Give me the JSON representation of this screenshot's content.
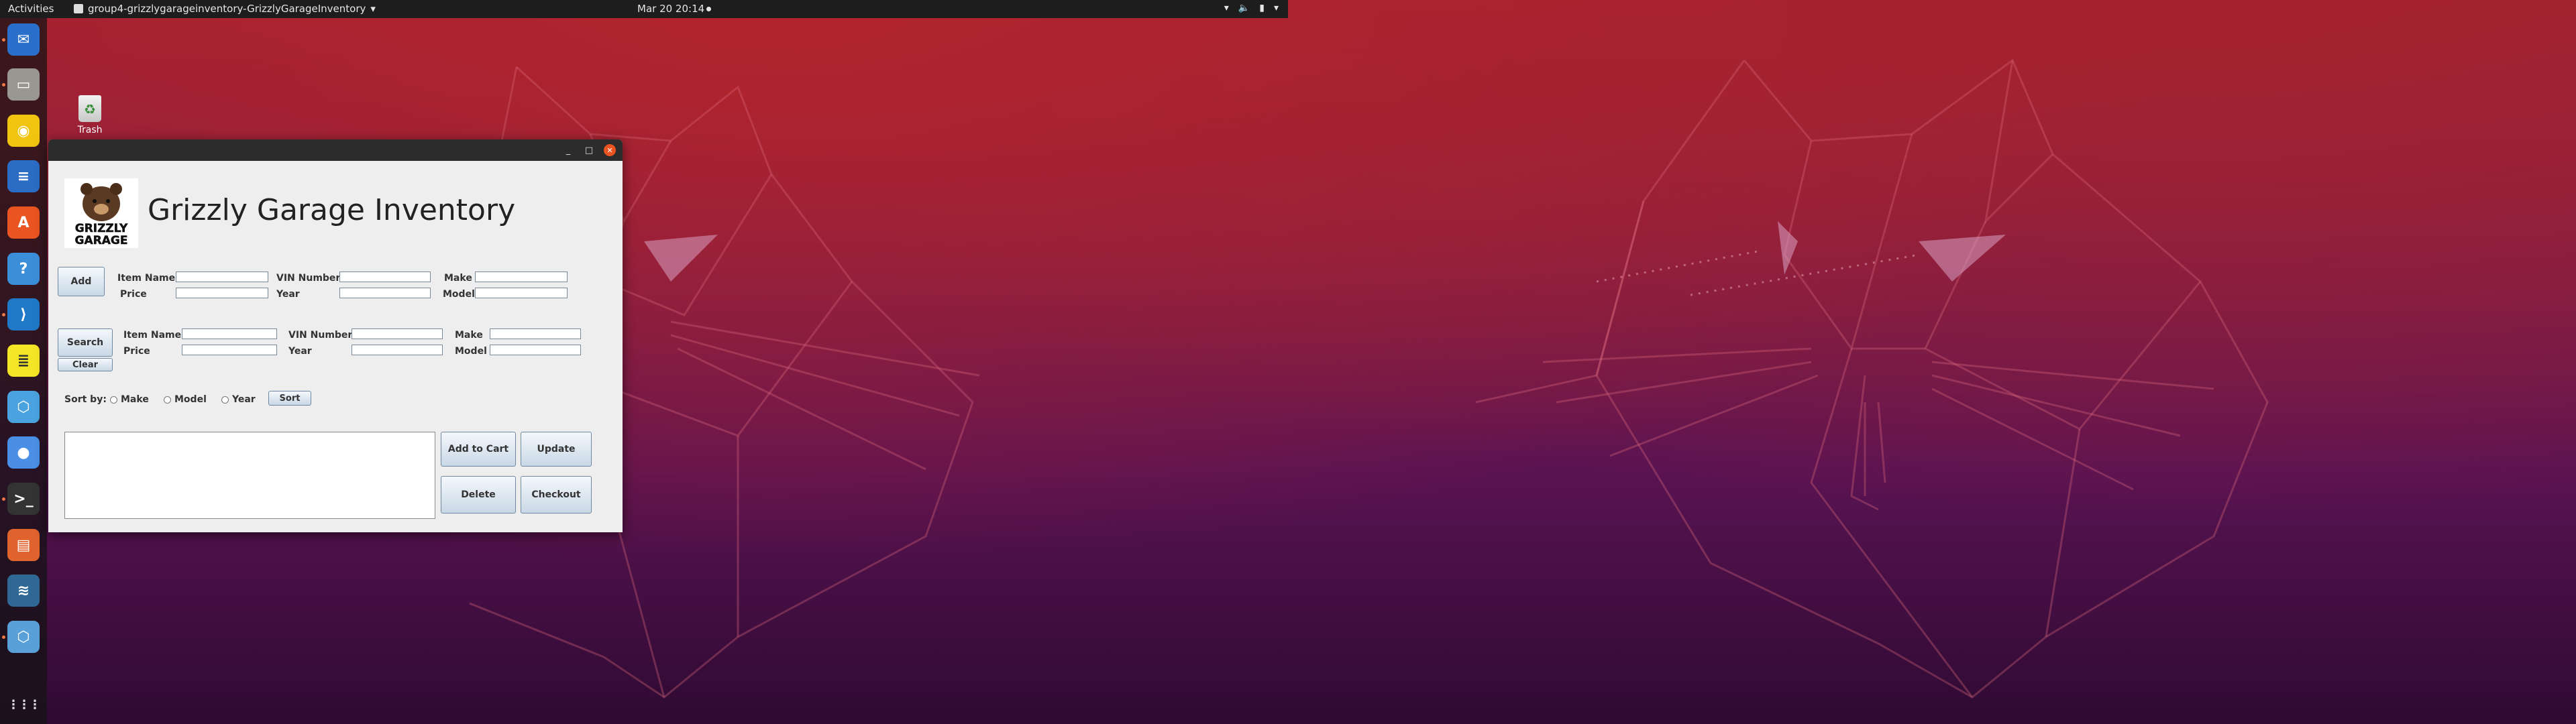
{
  "topbar": {
    "activities": "Activities",
    "app_name": "group4-grizzlygarageinventory-GrizzlyGarageInventory",
    "app_menu_arrow": "▾",
    "clock": "Mar 20  20:14",
    "tray": {
      "network": "▾",
      "volume": "🔈",
      "battery": "▮",
      "menu": "▾"
    }
  },
  "dock": {
    "items": [
      {
        "name": "thunderbird-icon",
        "color": "#2a6fc9",
        "glyph": "✉"
      },
      {
        "name": "files-icon",
        "color": "#9a9690",
        "glyph": "▭"
      },
      {
        "name": "rhythmbox-icon",
        "color": "#f1c40f",
        "glyph": "◉"
      },
      {
        "name": "writer-icon",
        "color": "#2b6cc4",
        "glyph": "≡"
      },
      {
        "name": "software-icon",
        "color": "#e95420",
        "glyph": "A"
      },
      {
        "name": "help-icon",
        "color": "#3b8fd9",
        "glyph": "?"
      },
      {
        "name": "vscode-icon",
        "color": "#1f79c7",
        "glyph": "⟩"
      },
      {
        "name": "notes-icon",
        "color": "#f3e627",
        "glyph": "≣"
      },
      {
        "name": "sanity-icon",
        "color": "#4aa3df",
        "glyph": "⬡"
      },
      {
        "name": "chrome-icon",
        "color": "#4a8fe5",
        "glyph": "●"
      },
      {
        "name": "terminal-icon",
        "color": "#333333",
        "glyph": ">_"
      },
      {
        "name": "impress-icon",
        "color": "#e0622c",
        "glyph": "▤"
      },
      {
        "name": "mysql-workbench-icon",
        "color": "#2f6894",
        "glyph": "≋"
      },
      {
        "name": "netbeans-icon",
        "color": "#5aa0d8",
        "glyph": "⬡"
      }
    ],
    "show_apps": "⋮⋮⋮"
  },
  "desktop": {
    "trash_label": "Trash"
  },
  "window": {
    "title_controls": {
      "minimize": "_",
      "maximize": "□",
      "close": "✕"
    },
    "app_title": "Grizzly Garage Inventory",
    "logo_text": "GRIZZLY GARAGE",
    "add_section": {
      "button": "Add",
      "item_name": "Item Name",
      "vin": "VIN Number",
      "make": "Make",
      "price": "Price",
      "year": "Year",
      "model": "Model"
    },
    "search_section": {
      "search_button": "Search",
      "clear_button": "Clear",
      "item_name": "Item Name",
      "vin": "VIN Number",
      "make": "Make",
      "price": "Price",
      "year": "Year",
      "model": "Model"
    },
    "sort": {
      "label": "Sort by:",
      "options": [
        "Make",
        "Model",
        "Year"
      ],
      "button": "Sort"
    },
    "actions": {
      "add_to_cart": "Add to Cart",
      "update": "Update",
      "delete": "Delete",
      "checkout": "Checkout"
    }
  }
}
